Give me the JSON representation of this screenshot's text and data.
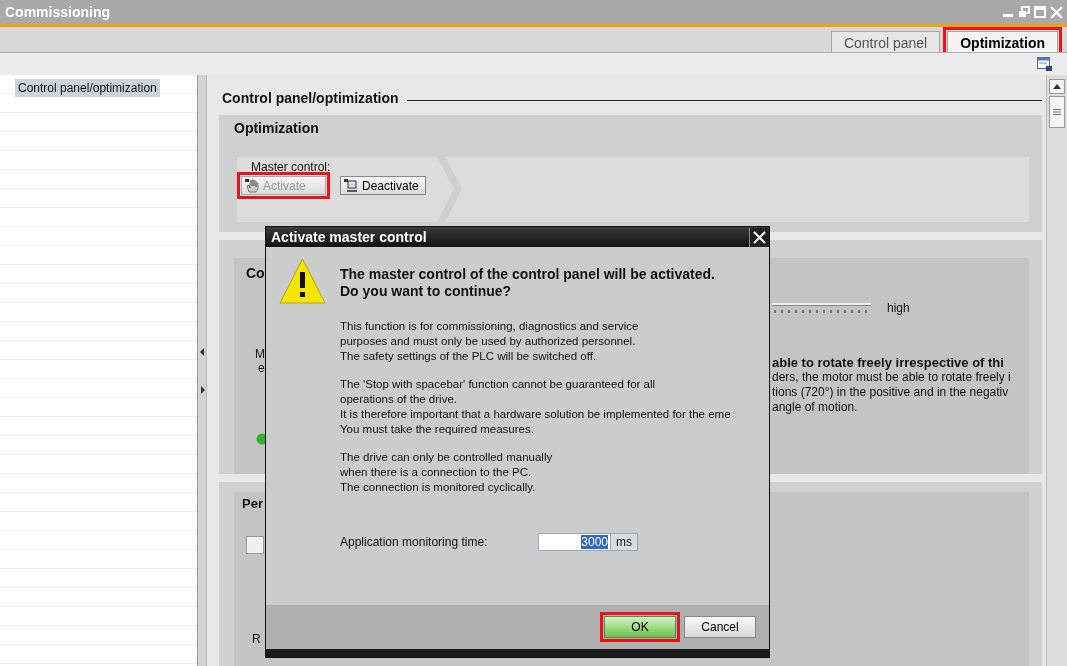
{
  "window": {
    "title": "Commissioning"
  },
  "tabs": [
    {
      "label": "Control panel",
      "selected": false,
      "highlighted": false
    },
    {
      "label": "Optimization",
      "selected": true,
      "highlighted": true
    }
  ],
  "sidebar": {
    "items": [
      {
        "label": "Control panel/optimization",
        "selected": true
      }
    ]
  },
  "page_heading": "Control panel/optimization",
  "optimization": {
    "title": "Optimization",
    "master_control_label": "Master control:",
    "buttons": [
      {
        "label": "Activate",
        "disabled": true,
        "highlighted": true
      },
      {
        "label": "Deactivate",
        "disabled": false,
        "highlighted": false
      }
    ]
  },
  "section_2": {
    "title": "Co",
    "left_lines": [
      "M",
      "e"
    ],
    "slider_end_label": "high",
    "warning_title": "able to rotate freely irrespective of thi",
    "lines": [
      "ders, the motor must be able to rotate freely i",
      "tions (720°) in the positive and in the negativ",
      "angle of motion."
    ]
  },
  "section_3": {
    "title": "Per",
    "label": "R"
  },
  "dialog": {
    "title": "Activate master control",
    "heading": [
      "The master control of the control panel will be activated.",
      "Do you want to continue?"
    ],
    "paragraphs": [
      [
        "This function is for commissioning, diagnostics and service",
        "purposes and must only be used by authorized personnel.",
        "The safety settings of the PLC will be switched off."
      ],
      [
        "The 'Stop with spacebar' function cannot be guaranteed for all",
        "operations of the drive.",
        "It is therefore important that a hardware solution be implemented for the eme",
        "You must take the required measures."
      ],
      [
        "The drive can only be controlled manually",
        "when there is a connection to the PC.",
        "The connection is monitored cyclically."
      ]
    ],
    "field": {
      "label": "Application monitoring time:",
      "value": "3000",
      "unit": "ms",
      "value_selected": true
    },
    "buttons": [
      {
        "label": "OK",
        "default": true,
        "highlighted": true
      },
      {
        "label": "Cancel",
        "default": false,
        "highlighted": false
      }
    ]
  }
}
